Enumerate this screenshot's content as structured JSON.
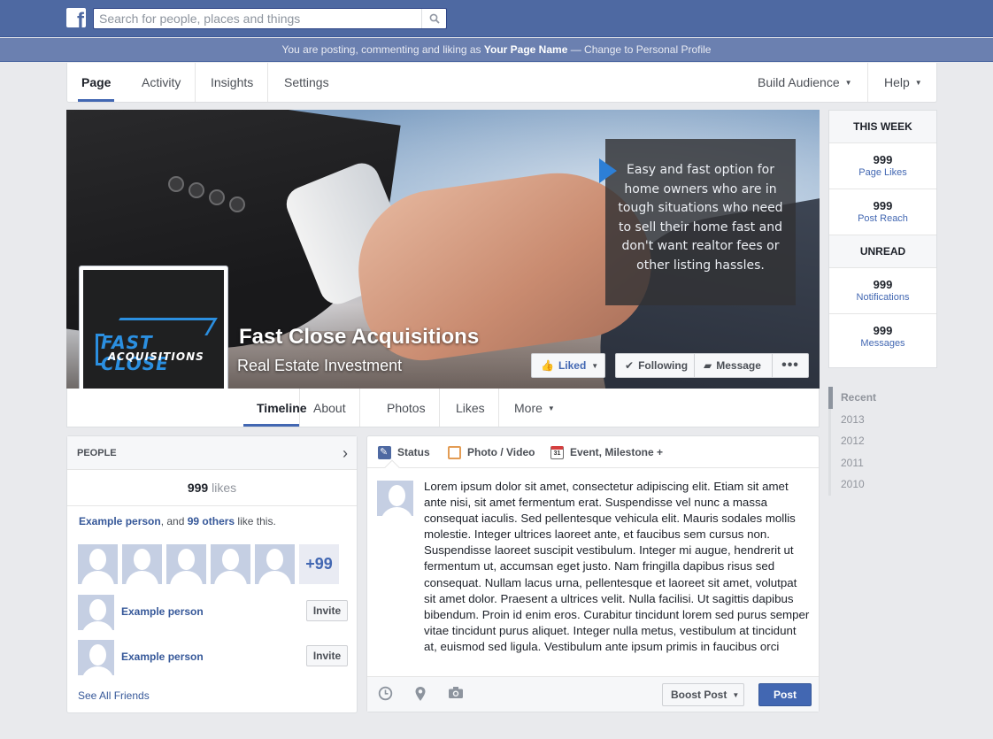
{
  "header": {
    "logo": "f",
    "search_placeholder": "Search for people, places and things"
  },
  "posting_as": {
    "prefix": "You are posting, commenting and liking as ",
    "page_name": "Your Page Name",
    "suffix": " — Change to Personal Profile"
  },
  "page_nav": {
    "tabs": [
      "Page",
      "Activity",
      "Insights",
      "Settings"
    ],
    "right": [
      "Build Audience",
      "Help"
    ]
  },
  "cover": {
    "quote": "Easy and fast option for home owners who are in tough situations who need to sell their home fast and don't want realtor fees or other listing hassles.",
    "page_title": "Fast Close Acquisitions",
    "category": "Real Estate Investment",
    "buttons": {
      "liked": "Liked",
      "following": "Following",
      "message": "Message",
      "more": "•••"
    }
  },
  "profile_logo": {
    "line1": "FAST CLOSE",
    "line2": "ACQUISITIONS"
  },
  "timeline_nav": [
    "Timeline",
    "About",
    "Photos",
    "Likes",
    "More"
  ],
  "stats": {
    "this_week": "THIS WEEK",
    "page_likes": {
      "n": "999",
      "label": "Page Likes"
    },
    "post_reach": {
      "n": "999",
      "label": "Post Reach"
    },
    "unread": "UNREAD",
    "notifications": {
      "n": "999",
      "label": "Notifications"
    },
    "messages": {
      "n": "999",
      "label": "Messages"
    }
  },
  "years": [
    "Recent",
    "2013",
    "2012",
    "2011",
    "2010"
  ],
  "people": {
    "title": "PEOPLE",
    "likes_count": "999",
    "likes_word": " likes",
    "friend_name": "Example person",
    "and": ", and ",
    "others": "99 others",
    "like_this": " like this.",
    "plus": "+99",
    "rows": [
      "Example person",
      "Example person"
    ],
    "invite": "Invite",
    "see_all": "See All Friends"
  },
  "composer": {
    "tabs": [
      "Status",
      "Photo / Video",
      "Event, Milestone +"
    ],
    "event_icon_text": "31",
    "text": "Lorem ipsum dolor sit amet, consectetur adipiscing elit. Etiam sit amet ante nisi, sit amet fermentum erat. Suspendisse vel nunc a massa consequat iaculis. Sed pellentesque vehicula elit. Mauris sodales mollis molestie. Integer ultrices laoreet ante, et faucibus sem cursus non. Suspendisse laoreet suscipit vestibulum. Integer mi augue, hendrerit ut fermentum ut, accumsan eget justo. Nam fringilla dapibus risus sed consequat. Nullam lacus urna, pellentesque et laoreet sit amet, volutpat sit amet dolor. Praesent a ultrices velit. Nulla facilisi. Ut sagittis dapibus bibendum. Proin id enim eros. Curabitur tincidunt lorem sed purus semper vitae tincidunt purus aliquet. Integer nulla metus, vestibulum at tincidunt at, euismod sed ligula. Vestibulum ante ipsum primis in faucibus orci",
    "boost": "Boost Post",
    "post": "Post"
  },
  "colors": {
    "brand": "#4e69a2",
    "link": "#365899",
    "accent": "#2d7fd6"
  }
}
